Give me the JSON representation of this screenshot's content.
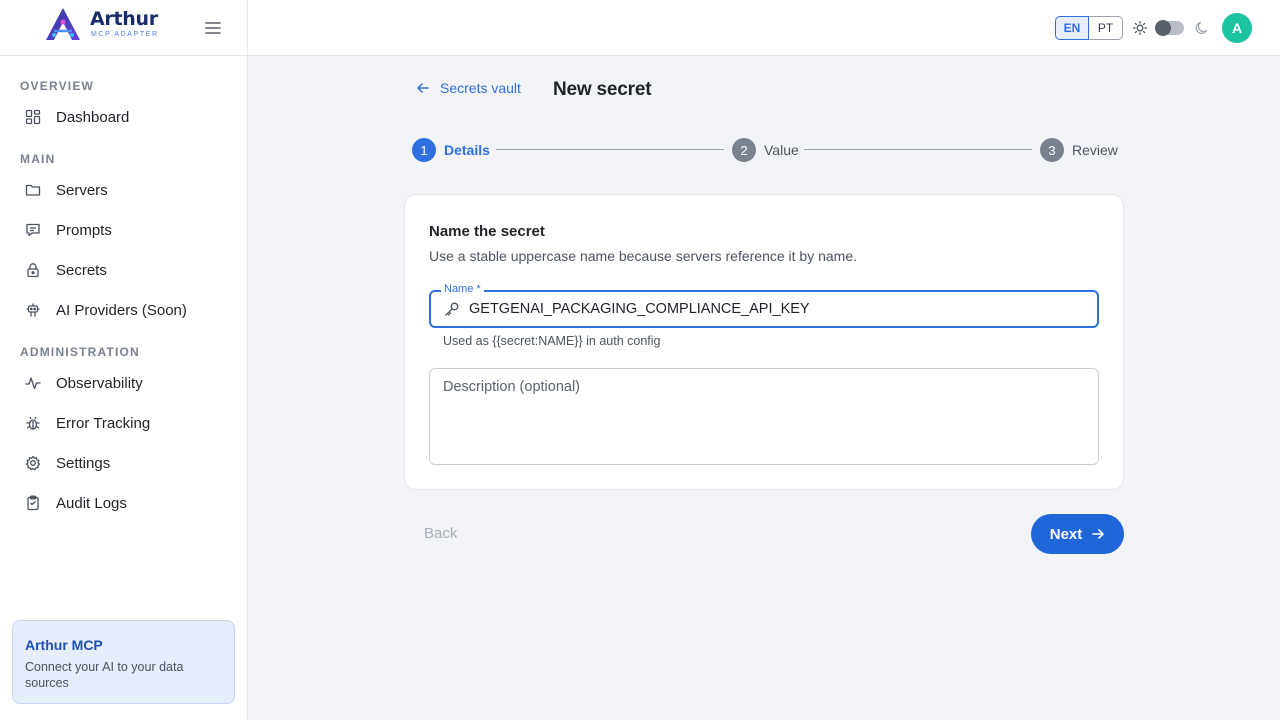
{
  "brand": {
    "name": "Arthur",
    "subtitle": "MCP ADAPTER"
  },
  "sidebar": {
    "sections": [
      {
        "label": "OVERVIEW"
      },
      {
        "label": "MAIN"
      },
      {
        "label": "ADMINISTRATION"
      }
    ],
    "items": [
      {
        "label": "Dashboard",
        "icon": "dashboard-icon"
      },
      {
        "label": "Servers",
        "icon": "folder-icon"
      },
      {
        "label": "Prompts",
        "icon": "message-icon"
      },
      {
        "label": "Secrets",
        "icon": "lock-icon"
      },
      {
        "label": "AI Providers (Soon)",
        "icon": "robot-icon"
      },
      {
        "label": "Observability",
        "icon": "activity-icon"
      },
      {
        "label": "Error Tracking",
        "icon": "bug-icon"
      },
      {
        "label": "Settings",
        "icon": "gear-icon"
      },
      {
        "label": "Audit Logs",
        "icon": "clipboard-icon"
      }
    ],
    "promo": {
      "title": "Arthur MCP",
      "text": "Connect your AI to your data sources"
    }
  },
  "topbar": {
    "languages": [
      "EN",
      "PT"
    ],
    "active_language": "EN",
    "avatar_initial": "A"
  },
  "main": {
    "back_link": "Secrets vault",
    "title": "New secret",
    "steps": [
      {
        "number": "1",
        "label": "Details",
        "state": "active"
      },
      {
        "number": "2",
        "label": "Value",
        "state": "pending"
      },
      {
        "number": "3",
        "label": "Review",
        "state": "pending"
      }
    ],
    "form": {
      "heading": "Name the secret",
      "subheading": "Use a stable uppercase name because servers reference it by name.",
      "name_label": "Name *",
      "name_value": "GETGENAI_PACKAGING_COMPLIANCE_API_KEY",
      "name_helper": "Used as {{secret:NAME}} in auth config",
      "description_placeholder": "Description (optional)"
    },
    "actions": {
      "back_label": "Back",
      "next_label": "Next"
    }
  },
  "colors": {
    "accent": "#1f66d9",
    "active_step": "#2f6fdf",
    "pending_step": "#6b7280",
    "avatar": "#1cc39f"
  }
}
